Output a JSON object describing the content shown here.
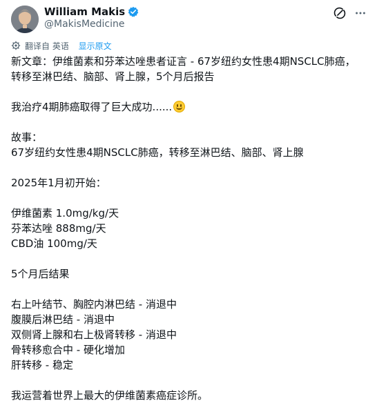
{
  "author": {
    "name": "William Makis",
    "handle": "@MakisMedicine",
    "verified": true
  },
  "icons": {
    "avatar": "avatar-photo",
    "verified": "verified-badge-icon",
    "grok": "grok-icon",
    "more": "more-options-icon",
    "translate": "gear-icon"
  },
  "translation": {
    "label": "翻译自 英语",
    "show_original": "显示原文"
  },
  "post": {
    "lines": [
      "新文章：伊维菌素和芬苯达唑患者证言 - 67岁纽约女性患4期NSCLC肺癌，",
      "转移至淋巴结、脑部、肾上腺，5个月后报告",
      "",
      "我治疗4期肺癌取得了巨大成功......",
      "",
      "故事：",
      "67岁纽约女性患4期NSCLC肺癌，转移至淋巴结、脑部、肾上腺",
      "",
      "2025年1月初开始：",
      "",
      "伊维菌素 1.0mg/kg/天",
      "芬苯达唑 888mg/天",
      "CBD油 100mg/天",
      "",
      "5个月后结果",
      "",
      "右上叶结节、胸腔内淋巴结 - 消退中",
      "腹膜后淋巴结 - 消退中",
      "双侧肾上腺和右上极肾转移 - 消退中",
      "骨转移愈合中 - 硬化增加",
      "肝转移 - 稳定",
      "",
      "我运营着世界上最大的伊维菌素癌症诊所。"
    ],
    "emoji_after_line": 3,
    "emoji_name": "grinning-face-emoji"
  },
  "colors": {
    "text": "#0f1419",
    "secondary": "#536471",
    "link": "#1d9bf0",
    "verified": "#1d9bf0"
  }
}
